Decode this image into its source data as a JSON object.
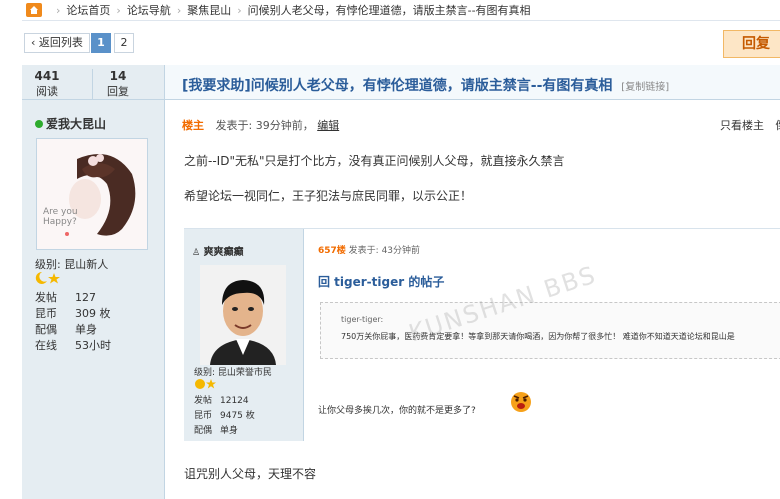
{
  "breadcrumb": {
    "items": [
      "论坛首页",
      "论坛导航",
      "聚焦昆山",
      "问候别人老父母，有悖伦理道德，请版主禁言--有图有真相"
    ]
  },
  "pager": {
    "back": "‹ 返回列表",
    "pages": [
      "1",
      "2"
    ],
    "reply": "回复"
  },
  "stats": {
    "views_value": "441",
    "views_label": "阅读",
    "replies_value": "14",
    "replies_label": "回复"
  },
  "author": {
    "name": "爱我大昆山",
    "avatar_text": "Are you\nHappy?",
    "level": "级别: 昆山新人",
    "info": [
      {
        "k": "发帖",
        "v": "127"
      },
      {
        "k": "昆币",
        "v": "309 枚"
      },
      {
        "k": "配偶",
        "v": "单身"
      },
      {
        "k": "在线",
        "v": "53小时"
      }
    ]
  },
  "post": {
    "title": "[我要求助]问候别人老父母，有悖伦理道德，请版主禁言--有图有真相",
    "copy_link": "[复制链接]",
    "lz": "楼主",
    "time": "发表于: 39分钟前，",
    "edit": "编辑",
    "only_lz": "只看楼主",
    "only_lz2": "倒",
    "line1": "之前--ID\"无私\"只是打个比方，没有真正问候别人父母，就直接永久禁言",
    "line2": "希望论坛一视同仁，王子犯法与庶民同罪，以示公正！",
    "line3": "诅咒别人父母，天理不容"
  },
  "embedded": {
    "uname": "爽爽癫癫",
    "level": "级别: 昆山荣誉市民",
    "info": [
      {
        "k": "发帖",
        "v": "12124"
      },
      {
        "k": "昆币",
        "v": "9475 枚"
      },
      {
        "k": "配偶",
        "v": "单身"
      }
    ],
    "floor": "657楼",
    "time": "发表于: 43分钟前",
    "reply_title": "回 tiger-tiger 的帖子",
    "quote_author": "tiger-tiger:",
    "quote_text": "750万关你屁事，医药费肯定要拿！等拿到那天请你喝酒，因为你帮了很多忙！ 难道你不知道天道论坛和昆山是",
    "line": "让你父母多挨几次，你的就不是更多了?",
    "watermark": "KUNSHAN BBS"
  },
  "colors": {
    "link_blue": "#2b5d9a",
    "accent_orange": "#f26c00",
    "sidebar_bg": "#e5edf2"
  }
}
